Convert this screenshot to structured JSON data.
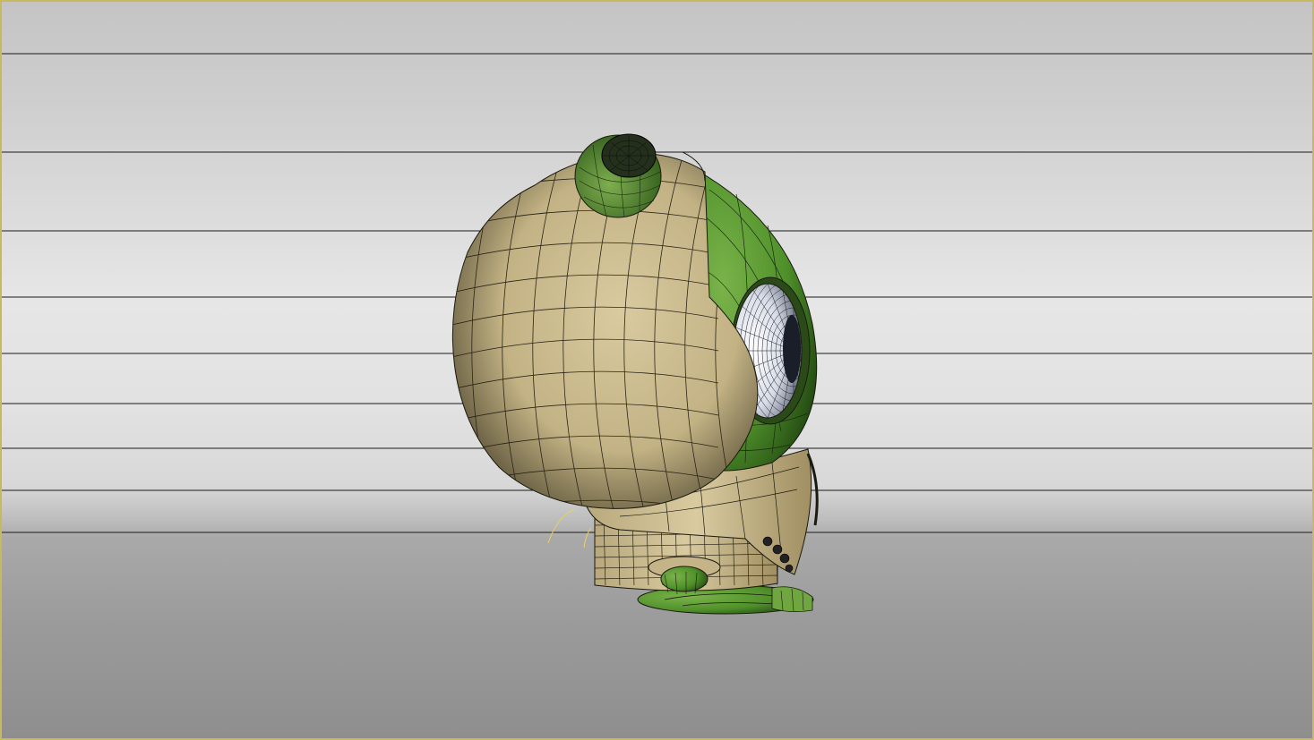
{
  "viewport": {
    "mode": "perspective-side-view",
    "border_color": "#c8b860",
    "background_colors": [
      "#c4c4c4",
      "#e6e6e6",
      "#8e8e8e"
    ]
  },
  "model": {
    "name": "",
    "skin_color": "#d4c49a",
    "body_color": "#4f8f2a",
    "wire_color": "#1a1a10",
    "icons": [
      "character-model-icon"
    ]
  }
}
